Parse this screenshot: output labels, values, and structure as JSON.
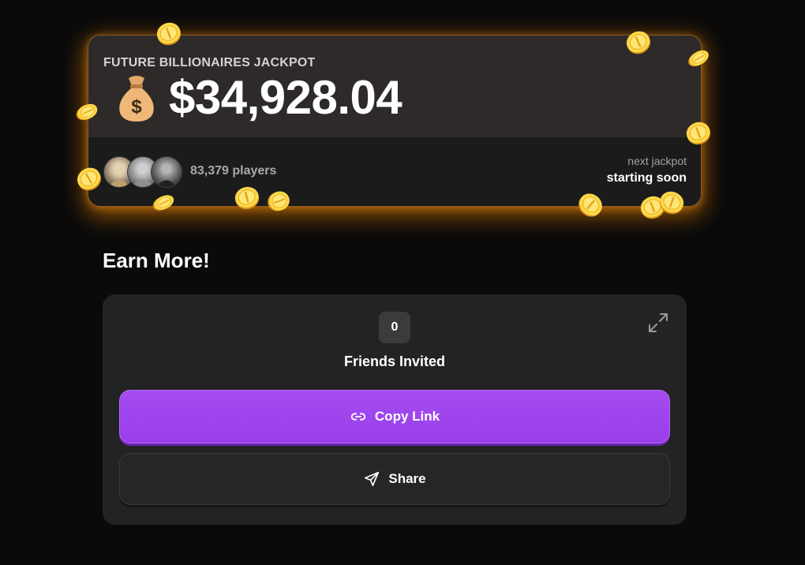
{
  "jackpot": {
    "label": "FUTURE BILLIONAIRES JACKPOT",
    "amount": "$34,928.04",
    "icon": "money-bag-icon",
    "players": "83,379 players",
    "next_label": "next jackpot",
    "next_value": "starting soon",
    "glow_color": "#ff8c00"
  },
  "earn": {
    "title": "Earn More!",
    "friends_count": "0",
    "friends_label": "Friends Invited",
    "copy_label": "Copy Link",
    "copy_icon": "link-icon",
    "share_label": "Share",
    "share_icon": "send-icon",
    "expand_icon": "expand-icon",
    "accent_color": "#a34bf0"
  }
}
